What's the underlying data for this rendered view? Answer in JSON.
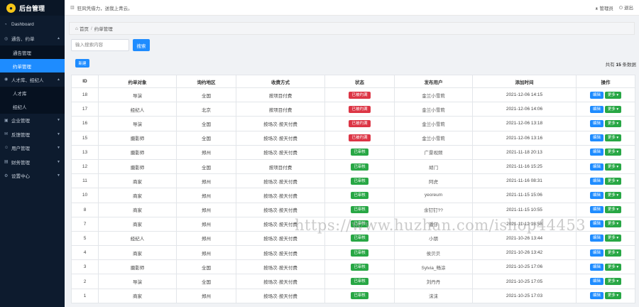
{
  "brand": {
    "title": "后台管理"
  },
  "sidebar": {
    "items": [
      {
        "icon": "gauge-icon",
        "label": "Dashboard",
        "has_children": false
      },
      {
        "icon": "bell-icon",
        "label": "通告、约单",
        "has_children": true,
        "expanded": true,
        "children": [
          {
            "label": "通告管理",
            "active": false
          },
          {
            "label": "约单管理",
            "active": true
          }
        ]
      },
      {
        "icon": "users-icon",
        "label": "人才库、经纪人",
        "has_children": true,
        "expanded": true,
        "children": [
          {
            "label": "人才库",
            "active": false
          },
          {
            "label": "经纪人",
            "active": false
          }
        ]
      },
      {
        "icon": "building-icon",
        "label": "企业管理",
        "has_children": true,
        "expanded": false
      },
      {
        "icon": "feedback-icon",
        "label": "反馈管理",
        "has_children": true,
        "expanded": false
      },
      {
        "icon": "user-icon",
        "label": "用户管理",
        "has_children": true,
        "expanded": false
      },
      {
        "icon": "wallet-icon",
        "label": "财务管理",
        "has_children": true,
        "expanded": false
      },
      {
        "icon": "gear-icon",
        "label": "设置中心",
        "has_children": true,
        "expanded": false
      }
    ]
  },
  "header": {
    "notice": "狂风凭借力，送我上青云。",
    "admin_label": "管理员",
    "logout_label": "退出"
  },
  "breadcrumb": {
    "home": "首页",
    "sep": "/",
    "current": "约单管理"
  },
  "search": {
    "placeholder": "输入搜索内容",
    "button": "搜索"
  },
  "toolbar": {
    "new_button": "新建",
    "total_prefix": "共有",
    "total_count": "15",
    "total_suffix": "条数据"
  },
  "table": {
    "headers": [
      "ID",
      "约单对象",
      "询约地区",
      "收费方式",
      "状态",
      "发布用户",
      "添加时间",
      "操作"
    ],
    "edit_label": "编辑",
    "more_label": "更多",
    "rows": [
      {
        "id": "18",
        "target": "导演",
        "region": "全国",
        "fee": "按项目付费",
        "status": "已被约满",
        "status_color": "red",
        "user": "金兰小雪莉",
        "time": "2021-12-06 14:15"
      },
      {
        "id": "17",
        "target": "经纪人",
        "region": "北京",
        "fee": "按项目付费",
        "status": "已被约满",
        "status_color": "red",
        "user": "金兰小雪莉",
        "time": "2021-12-06 14:06"
      },
      {
        "id": "16",
        "target": "导演",
        "region": "全国",
        "fee": "按场次·按天付费",
        "status": "已被约满",
        "status_color": "red",
        "user": "金兰小雪莉",
        "time": "2021-12-06 13:18"
      },
      {
        "id": "15",
        "target": "摄影师",
        "region": "全国",
        "fee": "按场次·按天付费",
        "status": "已被约满",
        "status_color": "red",
        "user": "金兰小雪莉",
        "time": "2021-12-06 13:16"
      },
      {
        "id": "13",
        "target": "摄影师",
        "region": "郑州",
        "fee": "按场次·按天付费",
        "status": "已审核",
        "status_color": "green",
        "user": "广景视频",
        "time": "2021-11-18 20:13"
      },
      {
        "id": "12",
        "target": "摄影师",
        "region": "全国",
        "fee": "按项目付费",
        "status": "已审核",
        "status_color": "green",
        "user": "胡门",
        "time": "2021-11-16 15:25"
      },
      {
        "id": "11",
        "target": "商家",
        "region": "郑州",
        "fee": "按场次·按天付费",
        "status": "已审核",
        "status_color": "green",
        "user": "阿虎",
        "time": "2021-11-16 08:31"
      },
      {
        "id": "10",
        "target": "商家",
        "region": "郑州",
        "fee": "按场次·按天付费",
        "status": "已审核",
        "status_color": "green",
        "user": "yeoreum",
        "time": "2021-11-15 15:06"
      },
      {
        "id": "8",
        "target": "商家",
        "region": "郑州",
        "fee": "按场次·按天付费",
        "status": "已审核",
        "status_color": "green",
        "user": "余钉钉??",
        "time": "2021-11-15 10:55"
      },
      {
        "id": "7",
        "target": "商家",
        "region": "郑州",
        "fee": "按场次·按天付费",
        "status": "已审核",
        "status_color": "green",
        "user": "潘仔",
        "time": "2021-11-12 18:58"
      },
      {
        "id": "5",
        "target": "经纪人",
        "region": "郑州",
        "fee": "按场次·按天付费",
        "status": "已审核",
        "status_color": "green",
        "user": "小朋",
        "time": "2021-10-26 13:44"
      },
      {
        "id": "4",
        "target": "商家",
        "region": "郑州",
        "fee": "按场次·按天付费",
        "status": "已审核",
        "status_color": "green",
        "user": "侯贝贝",
        "time": "2021-10-26 13:42"
      },
      {
        "id": "3",
        "target": "摄影师",
        "region": "全国",
        "fee": "按场次·按天付费",
        "status": "已审核",
        "status_color": "green",
        "user": "Sylvia_畅涂",
        "time": "2021-10-25 17:06"
      },
      {
        "id": "2",
        "target": "导演",
        "region": "全国",
        "fee": "按场次·按天付费",
        "status": "已审核",
        "status_color": "green",
        "user": "刘丹丹",
        "time": "2021-10-25 17:05"
      },
      {
        "id": "1",
        "target": "商家",
        "region": "郑州",
        "fee": "按场次·按天付费",
        "status": "已审核",
        "status_color": "green",
        "user": "沫沫",
        "time": "2021-10-25 17:03"
      }
    ]
  },
  "watermark": "https://www.huzhan.com/ishop44453",
  "colors": {
    "sidebar_bg": "#0d1b2e",
    "accent": "#1e8cff",
    "danger": "#dc3545",
    "success": "#28a745"
  }
}
